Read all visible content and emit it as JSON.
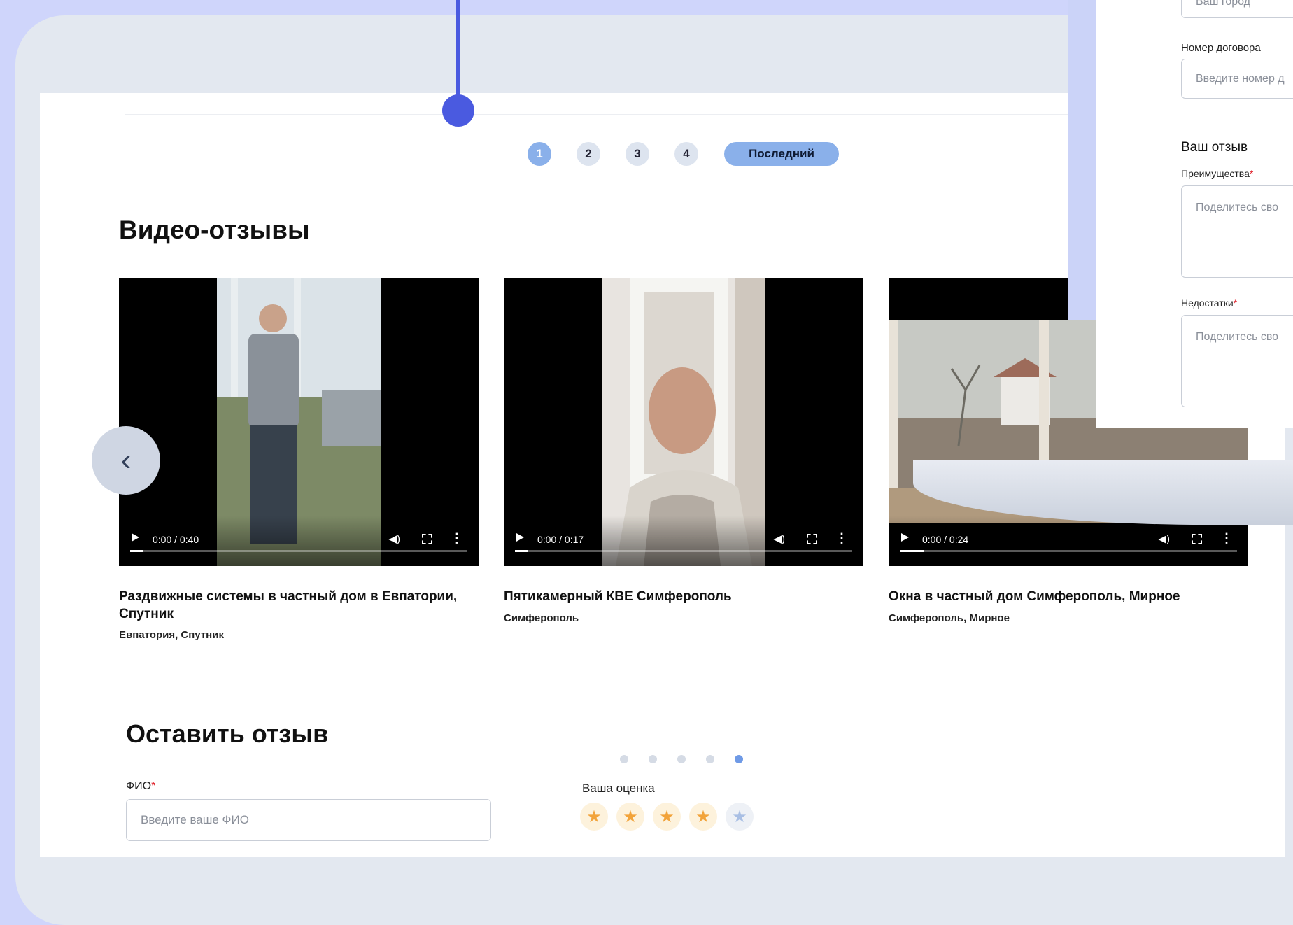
{
  "pagination": {
    "pages": [
      "1",
      "2",
      "3",
      "4"
    ],
    "active_page": "1",
    "last_label": "Последний"
  },
  "video_reviews": {
    "title": "Видео-отзывы",
    "videos": [
      {
        "time": "0:00 / 0:40",
        "caption": "Раздвижные системы в частный дом в Евпатории, Спутник",
        "location": "Евпатория, Спутник"
      },
      {
        "time": "0:00 / 0:17",
        "caption": "Пятикамерный КВЕ Симферополь",
        "location": "Симферополь"
      },
      {
        "time": "0:00 / 0:24",
        "caption": "Окна в частный дом Симферополь, Мирное",
        "location": "Симферополь, Мирное"
      }
    ],
    "slide_count": 5,
    "active_slide": 5
  },
  "leave_review": {
    "title": "Оставить отзыв",
    "name_label": "ФИО",
    "required_mark": "*",
    "name_placeholder": "Введите ваше ФИО",
    "rating_label": "Ваша оценка",
    "rating": 4,
    "rating_max": 5
  },
  "side_form": {
    "city_placeholder": "Ваш город",
    "contract_label": "Номер договора",
    "contract_placeholder": "Введите номер д",
    "review_heading": "Ваш отзыв",
    "pros_label": "Преимущества",
    "pros_placeholder": "Поделитесь сво",
    "cons_label": "Недостатки",
    "cons_placeholder": "Поделитесь сво",
    "required_mark": "*"
  },
  "colors": {
    "accent": "#8ab0ea",
    "pointer": "#4a5ae0",
    "background": "#cfd5fb",
    "star": "#f2a33a"
  }
}
